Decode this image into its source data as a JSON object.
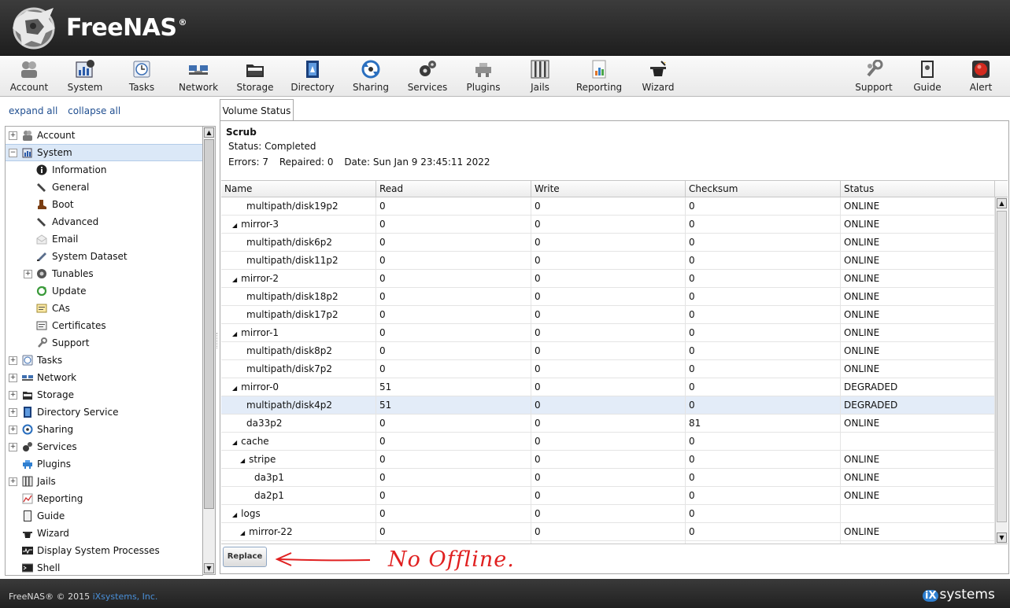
{
  "app": {
    "brand": "FreeNAS",
    "brand_mark": "®"
  },
  "toolbar": {
    "left": [
      {
        "label": "Account",
        "icon": "account-icon"
      },
      {
        "label": "System",
        "icon": "system-icon"
      },
      {
        "label": "Tasks",
        "icon": "tasks-icon"
      },
      {
        "label": "Network",
        "icon": "network-icon"
      },
      {
        "label": "Storage",
        "icon": "storage-icon"
      },
      {
        "label": "Directory",
        "icon": "directory-icon"
      },
      {
        "label": "Sharing",
        "icon": "sharing-icon"
      },
      {
        "label": "Services",
        "icon": "services-icon"
      },
      {
        "label": "Plugins",
        "icon": "plugins-icon"
      },
      {
        "label": "Jails",
        "icon": "jails-icon"
      },
      {
        "label": "Reporting",
        "icon": "reporting-icon"
      },
      {
        "label": "Wizard",
        "icon": "wizard-icon"
      }
    ],
    "right": [
      {
        "label": "Support",
        "icon": "support-icon"
      },
      {
        "label": "Guide",
        "icon": "guide-icon"
      },
      {
        "label": "Alert",
        "icon": "alert-icon"
      }
    ]
  },
  "sidebar": {
    "expand_all": "expand all",
    "collapse_all": "collapse all",
    "items": [
      {
        "label": "Account",
        "level": 0,
        "expander": "+",
        "icon": "account-icon"
      },
      {
        "label": "System",
        "level": 0,
        "expander": "−",
        "icon": "system-icon",
        "selected": true
      },
      {
        "label": "Information",
        "level": 1,
        "icon": "info-icon"
      },
      {
        "label": "General",
        "level": 1,
        "icon": "wrench-icon"
      },
      {
        "label": "Boot",
        "level": 1,
        "icon": "boot-icon"
      },
      {
        "label": "Advanced",
        "level": 1,
        "icon": "wrench-icon"
      },
      {
        "label": "Email",
        "level": 1,
        "icon": "email-icon"
      },
      {
        "label": "System Dataset",
        "level": 1,
        "icon": "dataset-icon"
      },
      {
        "label": "Tunables",
        "level": 1,
        "expander": "+",
        "icon": "tunables-icon"
      },
      {
        "label": "Update",
        "level": 1,
        "icon": "update-icon"
      },
      {
        "label": "CAs",
        "level": 1,
        "icon": "ca-icon"
      },
      {
        "label": "Certificates",
        "level": 1,
        "icon": "certificate-icon"
      },
      {
        "label": "Support",
        "level": 1,
        "icon": "support-icon"
      },
      {
        "label": "Tasks",
        "level": 0,
        "expander": "+",
        "icon": "tasks-icon"
      },
      {
        "label": "Network",
        "level": 0,
        "expander": "+",
        "icon": "network-icon"
      },
      {
        "label": "Storage",
        "level": 0,
        "expander": "+",
        "icon": "storage-icon"
      },
      {
        "label": "Directory Service",
        "level": 0,
        "expander": "+",
        "icon": "directory-icon"
      },
      {
        "label": "Sharing",
        "level": 0,
        "expander": "+",
        "icon": "sharing-icon"
      },
      {
        "label": "Services",
        "level": 0,
        "expander": "+",
        "icon": "services-icon"
      },
      {
        "label": "Plugins",
        "level": 0,
        "icon": "plugins-icon"
      },
      {
        "label": "Jails",
        "level": 0,
        "expander": "+",
        "icon": "jails-icon"
      },
      {
        "label": "Reporting",
        "level": 0,
        "icon": "reporting-icon"
      },
      {
        "label": "Guide",
        "level": 0,
        "icon": "guide-icon"
      },
      {
        "label": "Wizard",
        "level": 0,
        "icon": "wizard-icon"
      },
      {
        "label": "Display System Processes",
        "level": 0,
        "icon": "processes-icon"
      },
      {
        "label": "Shell",
        "level": 0,
        "icon": "shell-icon"
      }
    ]
  },
  "tab": {
    "label": "Volume Status"
  },
  "scrub": {
    "title": "Scrub",
    "status": "Status: Completed",
    "errors": "Errors: 7",
    "repaired": "Repaired: 0",
    "date": "Date: Sun Jan 9 23:45:11 2022"
  },
  "grid": {
    "columns": [
      "Name",
      "Read",
      "Write",
      "Checksum",
      "Status"
    ],
    "rows": [
      {
        "name": "multipath/disk19p2",
        "indent": 2,
        "read": "0",
        "write": "0",
        "checksum": "0",
        "status": "ONLINE"
      },
      {
        "name": "mirror-3",
        "indent": 1,
        "toggle": true,
        "read": "0",
        "write": "0",
        "checksum": "0",
        "status": "ONLINE"
      },
      {
        "name": "multipath/disk6p2",
        "indent": 2,
        "read": "0",
        "write": "0",
        "checksum": "0",
        "status": "ONLINE"
      },
      {
        "name": "multipath/disk11p2",
        "indent": 2,
        "read": "0",
        "write": "0",
        "checksum": "0",
        "status": "ONLINE"
      },
      {
        "name": "mirror-2",
        "indent": 1,
        "toggle": true,
        "read": "0",
        "write": "0",
        "checksum": "0",
        "status": "ONLINE"
      },
      {
        "name": "multipath/disk18p2",
        "indent": 2,
        "read": "0",
        "write": "0",
        "checksum": "0",
        "status": "ONLINE"
      },
      {
        "name": "multipath/disk17p2",
        "indent": 2,
        "read": "0",
        "write": "0",
        "checksum": "0",
        "status": "ONLINE"
      },
      {
        "name": "mirror-1",
        "indent": 1,
        "toggle": true,
        "read": "0",
        "write": "0",
        "checksum": "0",
        "status": "ONLINE"
      },
      {
        "name": "multipath/disk8p2",
        "indent": 2,
        "read": "0",
        "write": "0",
        "checksum": "0",
        "status": "ONLINE"
      },
      {
        "name": "multipath/disk7p2",
        "indent": 2,
        "read": "0",
        "write": "0",
        "checksum": "0",
        "status": "ONLINE"
      },
      {
        "name": "mirror-0",
        "indent": 1,
        "toggle": true,
        "read": "51",
        "write": "0",
        "checksum": "0",
        "status": "DEGRADED"
      },
      {
        "name": "multipath/disk4p2",
        "indent": 2,
        "read": "51",
        "write": "0",
        "checksum": "0",
        "status": "DEGRADED",
        "selected": true
      },
      {
        "name": "da33p2",
        "indent": 2,
        "read": "0",
        "write": "0",
        "checksum": "81",
        "status": "ONLINE"
      },
      {
        "name": "cache",
        "indent": 1,
        "toggle": true,
        "read": "0",
        "write": "0",
        "checksum": "0",
        "status": ""
      },
      {
        "name": "stripe",
        "indent": 2,
        "toggle": true,
        "read": "0",
        "write": "0",
        "checksum": "0",
        "status": "ONLINE"
      },
      {
        "name": "da3p1",
        "indent": 3,
        "read": "0",
        "write": "0",
        "checksum": "0",
        "status": "ONLINE"
      },
      {
        "name": "da2p1",
        "indent": 3,
        "read": "0",
        "write": "0",
        "checksum": "0",
        "status": "ONLINE"
      },
      {
        "name": "logs",
        "indent": 1,
        "toggle": true,
        "read": "0",
        "write": "0",
        "checksum": "0",
        "status": ""
      },
      {
        "name": "mirror-22",
        "indent": 2,
        "toggle": true,
        "read": "0",
        "write": "0",
        "checksum": "0",
        "status": "ONLINE"
      },
      {
        "name": "",
        "indent": 2,
        "read": "",
        "write": "",
        "checksum": "",
        "status": ""
      }
    ]
  },
  "actions": {
    "replace": "Replace"
  },
  "annotation": {
    "text": "No Offline."
  },
  "footer": {
    "copyright": "FreeNAS® © 2015",
    "company": "iXsystems, Inc.",
    "logo_ix": "iX",
    "logo_rest": "systems"
  },
  "colors": {
    "annotation": "#e02020",
    "selected_row": "#e3ecf8",
    "link": "#1f4e90"
  }
}
